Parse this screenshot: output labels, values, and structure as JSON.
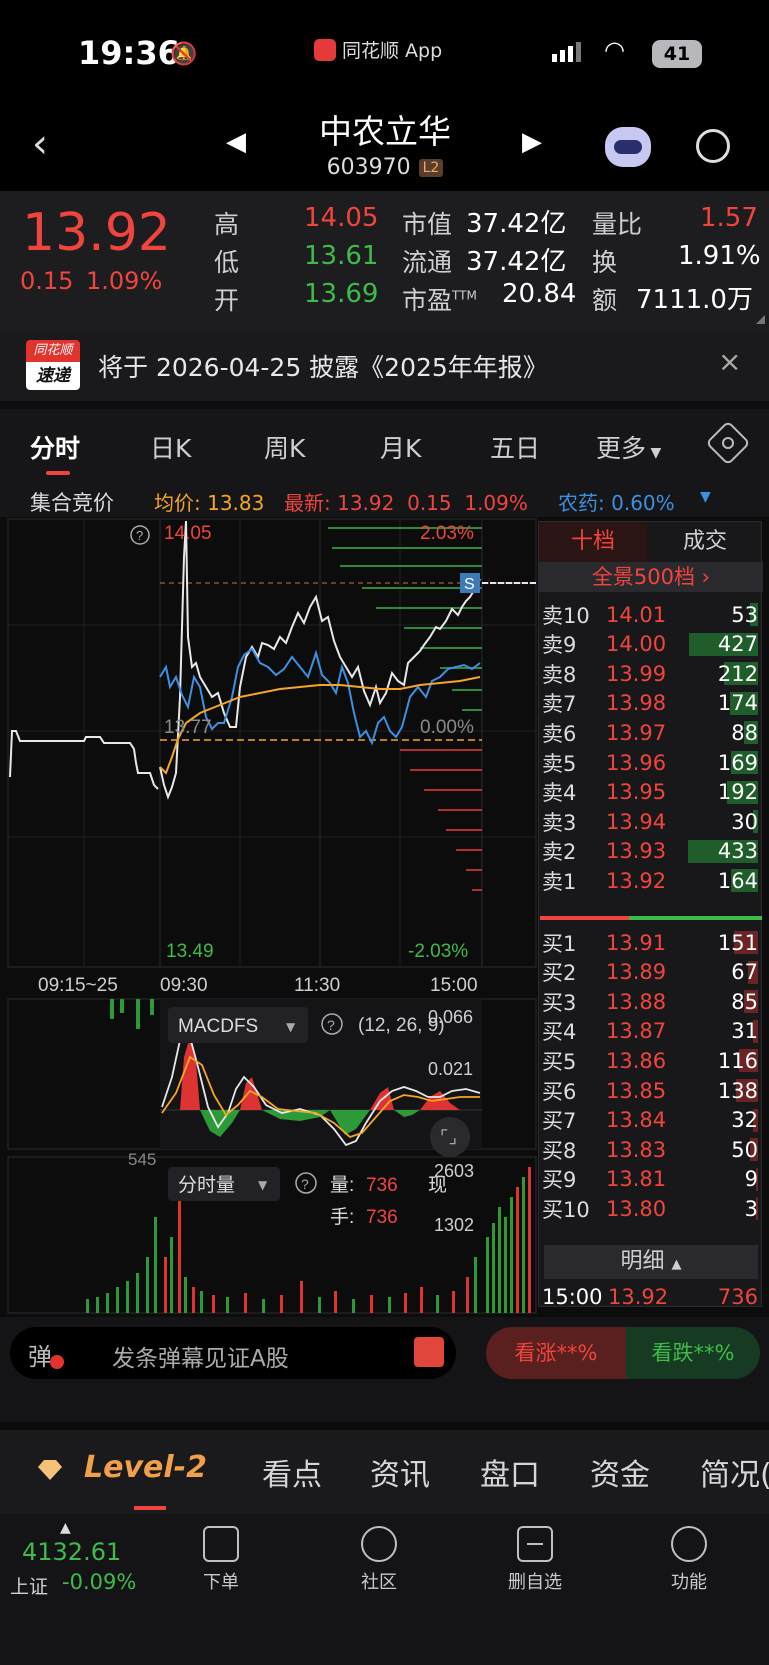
{
  "status_bar": {
    "time": "19:36",
    "app_label": "同花顺 App",
    "battery": "41"
  },
  "header": {
    "stock_name": "中农立华",
    "stock_code": "603970",
    "level_badge": "L2"
  },
  "quote": {
    "price": "13.92",
    "change": "0.15",
    "change_pct": "1.09%",
    "high_label": "高",
    "high": "14.05",
    "low_label": "低",
    "low": "13.61",
    "open_label": "开",
    "open": "13.69",
    "mcap_label": "市值",
    "mcap": "37.42亿",
    "float_label": "流通",
    "float": "37.42亿",
    "pe_label": "市盈",
    "pe_sup": "TTM",
    "pe": "20.84",
    "vr_label": "量比",
    "vr": "1.57",
    "turnover_label": "换",
    "turnover": "1.91%",
    "amount_label": "额",
    "amount": "7111.0万"
  },
  "notice": {
    "badge_top": "同花顺",
    "badge_bottom": "速递",
    "text": "将于 2026-04-25 披露《2025年年报》"
  },
  "tabs": [
    "分时",
    "日K",
    "周K",
    "月K",
    "五日",
    "更多"
  ],
  "info_line": {
    "auction": "集合竞价",
    "avg_label": "均价:",
    "avg": "13.83",
    "latest_label": "最新:",
    "latest": "13.92",
    "chg": "0.15",
    "chg_pct": "1.09%",
    "sector_label": "农药:",
    "sector_pct": "0.60%"
  },
  "chart_labels": {
    "top_price": "14.05",
    "top_pct": "2.03%",
    "mid_price": "13.77",
    "mid_pct": "0.00%",
    "bottom_price": "13.49",
    "bottom_pct": "-2.03%",
    "t_auction": "09:15~25",
    "t_open": "09:30",
    "t_mid": "11:30",
    "t_close": "15:00",
    "s_marker": "S",
    "macd_name": "MACDFS",
    "macd_params": "(12, 26, 9)",
    "macd_top": "0.066",
    "macd_mid": "0.021",
    "vol_name": "分时量",
    "vol_qty_label": "量:",
    "vol_qty": "736",
    "vol_now": "现",
    "vol_hand_label": "手:",
    "vol_hand": "736",
    "vol_top": "2603",
    "vol_mid": "1302",
    "auction_vol": "545"
  },
  "order_book": {
    "tab_level": "十档",
    "tab_trades": "成交",
    "full_depth": "全景500档 ›",
    "asks": [
      {
        "label": "卖10",
        "price": "14.01",
        "vol": "53",
        "frac": 0.12
      },
      {
        "label": "卖9",
        "price": "14.00",
        "vol": "427",
        "frac": 0.98
      },
      {
        "label": "卖8",
        "price": "13.99",
        "vol": "212",
        "frac": 0.49
      },
      {
        "label": "卖7",
        "price": "13.98",
        "vol": "174",
        "frac": 0.4
      },
      {
        "label": "卖6",
        "price": "13.97",
        "vol": "88",
        "frac": 0.2
      },
      {
        "label": "卖5",
        "price": "13.96",
        "vol": "169",
        "frac": 0.39
      },
      {
        "label": "卖4",
        "price": "13.95",
        "vol": "192",
        "frac": 0.44
      },
      {
        "label": "卖3",
        "price": "13.94",
        "vol": "30",
        "frac": 0.07
      },
      {
        "label": "卖2",
        "price": "13.93",
        "vol": "433",
        "frac": 1.0
      },
      {
        "label": "卖1",
        "price": "13.92",
        "vol": "164",
        "frac": 0.38
      }
    ],
    "bids": [
      {
        "label": "买1",
        "price": "13.91",
        "vol": "151",
        "frac": 0.35
      },
      {
        "label": "买2",
        "price": "13.89",
        "vol": "67",
        "frac": 0.15
      },
      {
        "label": "买3",
        "price": "13.88",
        "vol": "85",
        "frac": 0.2
      },
      {
        "label": "买4",
        "price": "13.87",
        "vol": "31",
        "frac": 0.07
      },
      {
        "label": "买5",
        "price": "13.86",
        "vol": "116",
        "frac": 0.27
      },
      {
        "label": "买6",
        "price": "13.85",
        "vol": "138",
        "frac": 0.32
      },
      {
        "label": "买7",
        "price": "13.84",
        "vol": "32",
        "frac": 0.07
      },
      {
        "label": "买8",
        "price": "13.83",
        "vol": "50",
        "frac": 0.12
      },
      {
        "label": "买9",
        "price": "13.81",
        "vol": "9",
        "frac": 0.02
      },
      {
        "label": "买10",
        "price": "13.80",
        "vol": "3",
        "frac": 0.01
      }
    ],
    "detail_label": "明细",
    "last_trade": {
      "time": "15:00",
      "price": "13.92",
      "vol": "736"
    }
  },
  "danmaku": {
    "icon_char": "弹",
    "placeholder": "发条弹幕见证A股",
    "bull": "看涨**%",
    "bear": "看跌**%"
  },
  "bottom_tabs": [
    "Level-2",
    "看点",
    "资讯",
    "盘口",
    "资金",
    "简况("
  ],
  "dock": {
    "index_value": "4132.61",
    "index_name": "上证",
    "index_pct": "-0.09%",
    "items": [
      "下单",
      "社区",
      "删自选",
      "功能"
    ]
  },
  "colors": {
    "up": "#f0453e",
    "down": "#3dbb4b",
    "avg_line": "#f5a623",
    "sector_line": "#3d8fe0",
    "price_line": "#e8e8ea"
  }
}
